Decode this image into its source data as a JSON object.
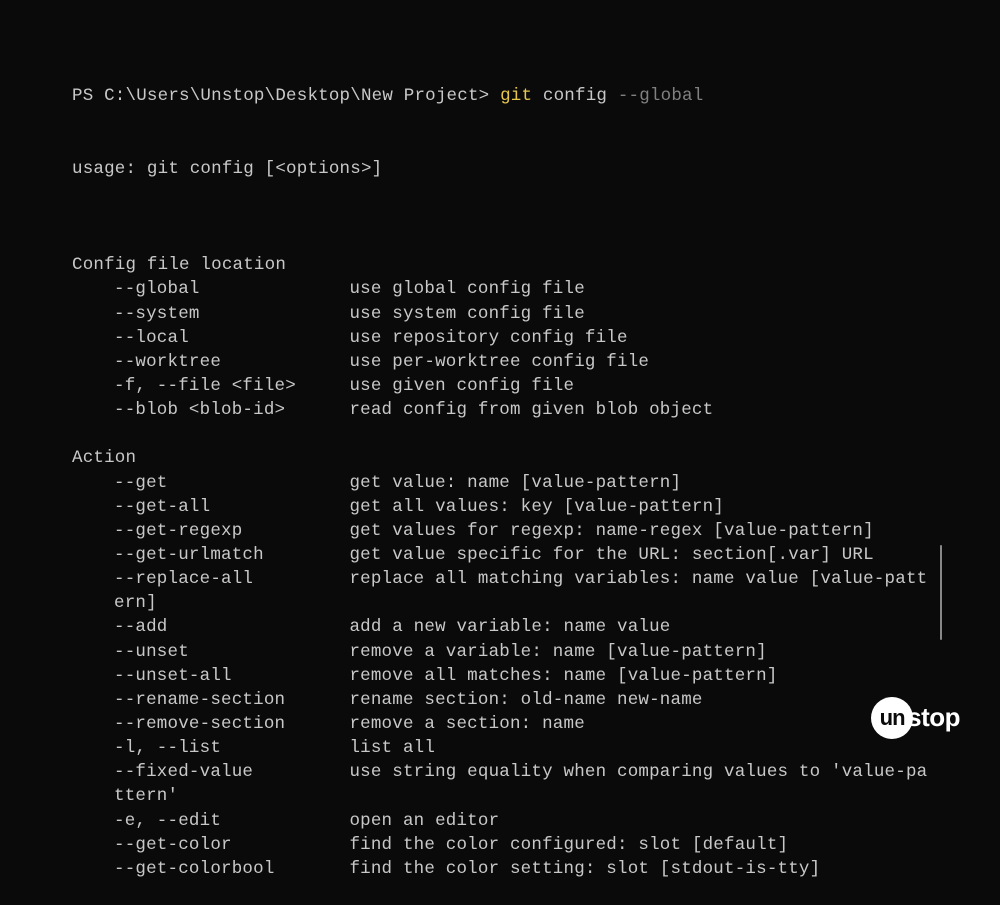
{
  "prompt": {
    "prefix": "PS C:\\Users\\Unstop\\Desktop\\New Project> ",
    "cmd_highlight": "git",
    "cmd_rest": " config ",
    "cmd_flag": "--global"
  },
  "usage": "usage: git config [<options>]",
  "sections": [
    {
      "title": "Config file location",
      "options": [
        {
          "flag": "--global",
          "desc": "use global config file"
        },
        {
          "flag": "--system",
          "desc": "use system config file"
        },
        {
          "flag": "--local",
          "desc": "use repository config file"
        },
        {
          "flag": "--worktree",
          "desc": "use per-worktree config file"
        },
        {
          "flag": "-f, --file <file>",
          "desc": "use given config file"
        },
        {
          "flag": "--blob <blob-id>",
          "desc": "read config from given blob object"
        }
      ]
    },
    {
      "title": "Action",
      "options": [
        {
          "flag": "--get",
          "desc": "get value: name [value-pattern]"
        },
        {
          "flag": "--get-all",
          "desc": "get all values: key [value-pattern]"
        },
        {
          "flag": "--get-regexp",
          "desc": "get values for regexp: name-regex [value-pattern]"
        },
        {
          "flag": "--get-urlmatch",
          "desc": "get value specific for the URL: section[.var] URL"
        },
        {
          "flag": "--replace-all",
          "desc": "replace all matching variables: name value [value-pattern]"
        },
        {
          "flag": "--add",
          "desc": "add a new variable: name value"
        },
        {
          "flag": "--unset",
          "desc": "remove a variable: name [value-pattern]"
        },
        {
          "flag": "--unset-all",
          "desc": "remove all matches: name [value-pattern]"
        },
        {
          "flag": "--rename-section",
          "desc": "rename section: old-name new-name"
        },
        {
          "flag": "--remove-section",
          "desc": "remove a section: name"
        },
        {
          "flag": "-l, --list",
          "desc": "list all"
        },
        {
          "flag": "--fixed-value",
          "desc": "use string equality when comparing values to 'value-pattern'"
        },
        {
          "flag": "-e, --edit",
          "desc": "open an editor"
        },
        {
          "flag": "--get-color",
          "desc": "find the color configured: slot [default]"
        },
        {
          "flag": "--get-colorbool",
          "desc": "find the color setting: slot [stdout-is-tty]"
        }
      ]
    }
  ],
  "flag_column_width": 22,
  "logo": {
    "circle": "un",
    "text": "stop"
  }
}
